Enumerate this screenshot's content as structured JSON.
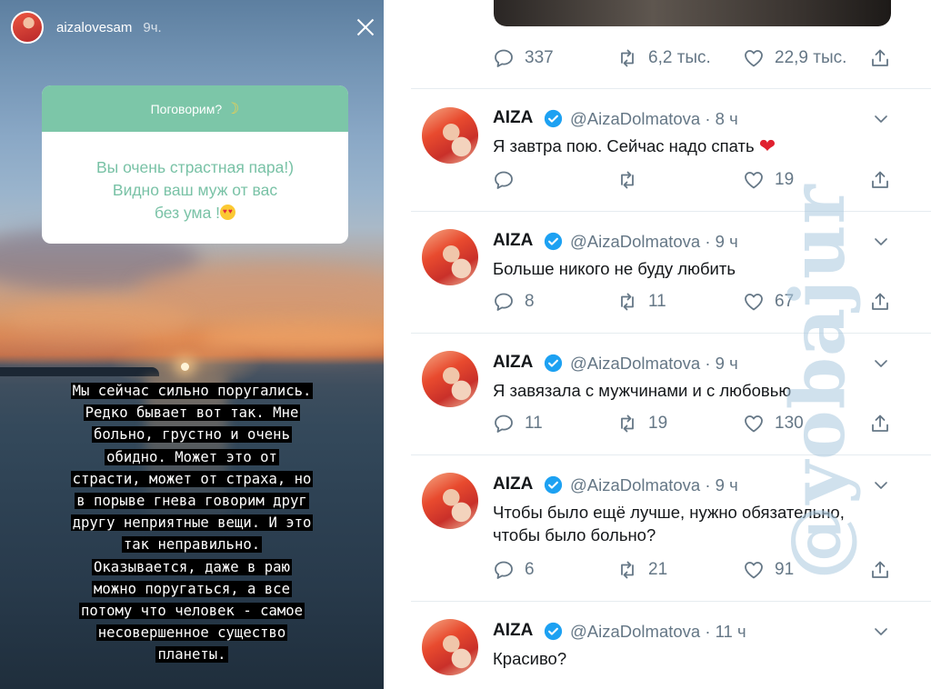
{
  "story": {
    "username": "aizalovesam",
    "time": "9ч.",
    "question_card": {
      "header": "Поговорим?",
      "body_lines": [
        "Вы очень страстная пара!)",
        "Видно ваш муж от вас",
        "без ума !"
      ]
    },
    "text_lines": [
      "Мы сейчас сильно поругались.",
      "Редко бывает вот так. Мне",
      "больно, грустно и очень",
      "обидно. Может это от",
      "страсти, может от страха, но",
      "в порыве гнева говорим друг",
      "другу неприятные вещи. И это",
      "так неправильно.",
      "Оказывается, даже в раю",
      "можно поругаться, а все",
      "потому что человек - самое",
      "несовершенное существо",
      "планеты."
    ]
  },
  "feed": {
    "top_actions": {
      "replies": "337",
      "retweets": "6,2 тыс.",
      "likes": "22,9 тыс."
    },
    "tweets": [
      {
        "name": "AIZA",
        "handle": "@AizaDolmatova · 8 ч",
        "text": "Я завтра пою. Сейчас надо спать",
        "replies": "",
        "retweets": "",
        "likes": "19"
      },
      {
        "name": "AIZA",
        "handle": "@AizaDolmatova · 9 ч",
        "text": "Больше никого не буду любить",
        "replies": "8",
        "retweets": "11",
        "likes": "67"
      },
      {
        "name": "AIZA",
        "handle": "@AizaDolmatova · 9 ч",
        "text": "Я завязала с мужчинами и с любовью",
        "replies": "11",
        "retweets": "19",
        "likes": "130"
      },
      {
        "name": "AIZA",
        "handle": "@AizaDolmatova · 9 ч",
        "text_lines": [
          "Чтобы было ещё лучше, нужно обязательно,",
          "чтобы было больно?"
        ],
        "replies": "6",
        "retweets": "21",
        "likes": "91"
      },
      {
        "name": "AIZA",
        "handle": "@AizaDolmatova · 11 ч",
        "text": "Красиво?"
      }
    ]
  },
  "watermark": "@yobajur",
  "icons": {
    "close": "close-icon",
    "moon": "crescent-moon-icon",
    "heart_eyes": "heart-eyes-emoji-icon",
    "reply": "reply-icon",
    "retweet": "retweet-icon",
    "like": "like-icon",
    "share": "share-icon",
    "verified": "verified-badge-icon",
    "chevron": "chevron-down-icon",
    "red_heart": "red-heart-emoji-icon"
  },
  "colors": {
    "twitter_gray": "#657786",
    "verified_blue": "#1da1f2",
    "question_green": "#7cc6a8",
    "separator": "#e6ecf0"
  }
}
